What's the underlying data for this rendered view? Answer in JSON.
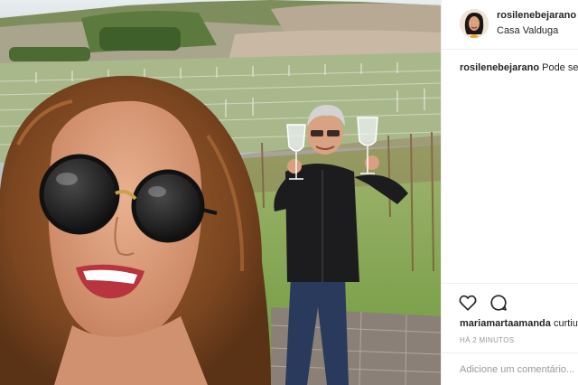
{
  "post": {
    "username": "rosilenebejarano",
    "location": "Casa Valduga",
    "caption_user": "rosilenebejarano",
    "caption_text": "Pode ser",
    "liker_user": "mariamartaamanda",
    "liker_text": "curtiu",
    "timestamp": "HÁ 2 MINUTOS",
    "comment_placeholder": "Adicione um comentário..."
  },
  "icons": {
    "like": "heart-icon",
    "comment": "comment-icon"
  },
  "colors": {
    "text": "#262626",
    "muted": "#999999",
    "divider": "#efefef"
  }
}
